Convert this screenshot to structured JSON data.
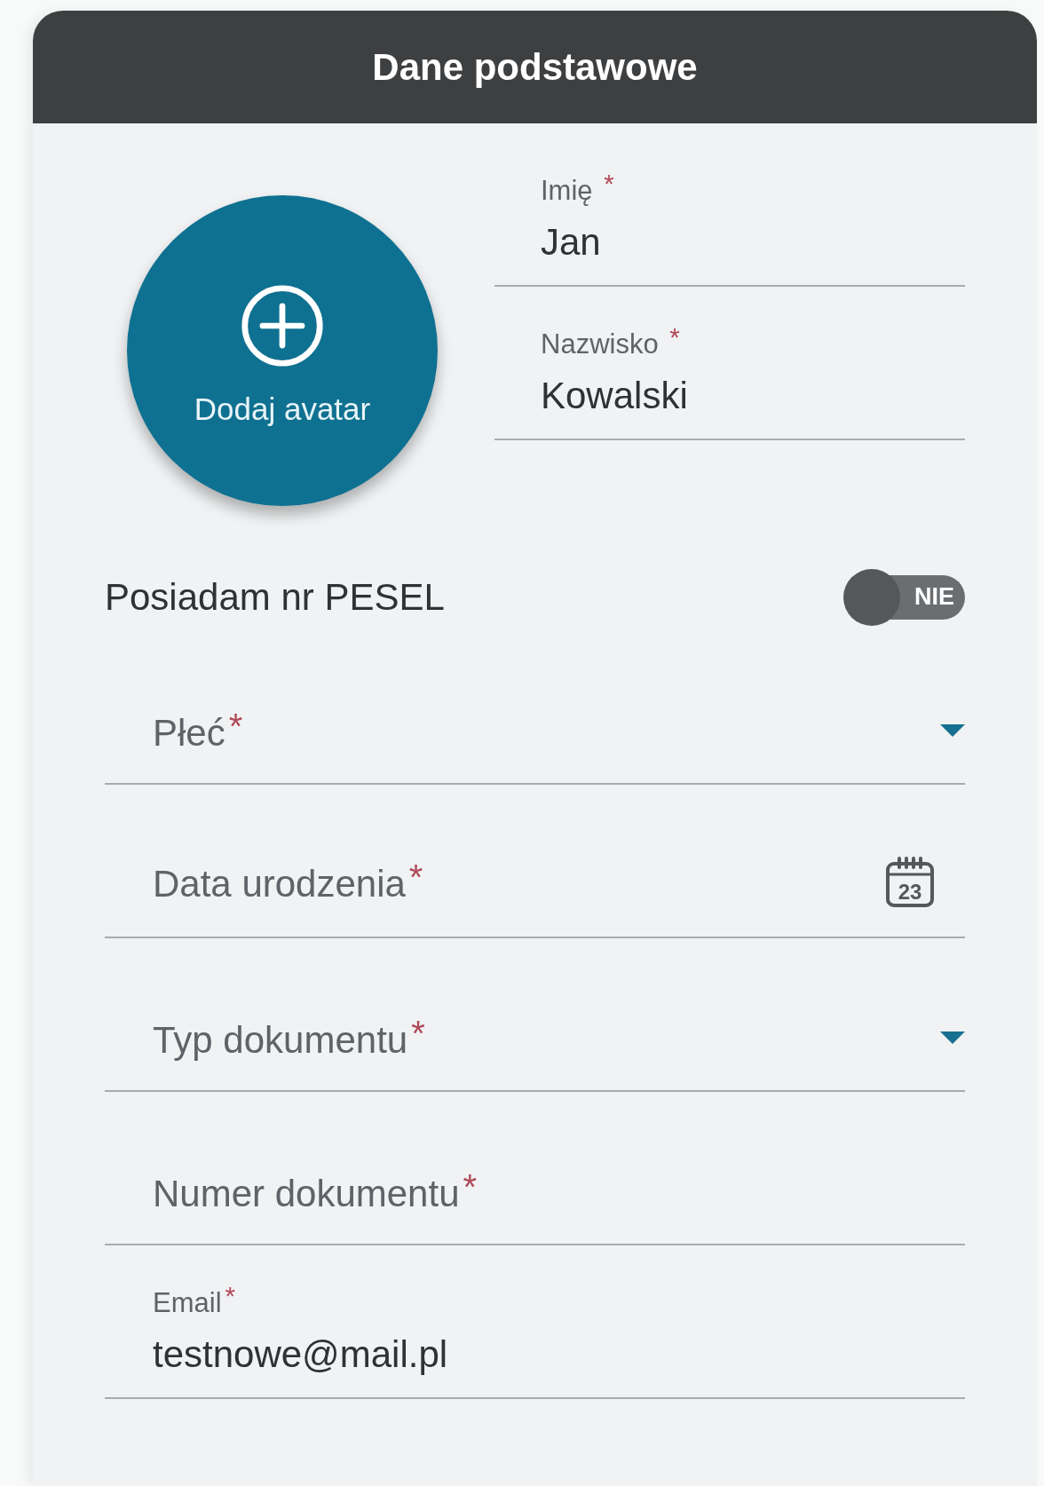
{
  "card": {
    "title": "Dane podstawowe"
  },
  "avatar": {
    "label": "Dodaj avatar"
  },
  "name_fields": [
    {
      "kind": "filled",
      "label": "Imię",
      "mark": "*",
      "value": "Jan"
    },
    {
      "kind": "filled",
      "label": "Nazwisko",
      "mark": "*",
      "value": "Kowalski"
    }
  ],
  "pesel": {
    "label": "Posiadam nr PESEL",
    "on": false,
    "toggle_text": "NIE"
  },
  "fields": [
    {
      "kind": "dropdown",
      "label": "Płeć",
      "mark": "*"
    },
    {
      "kind": "date",
      "label": "Data urodzenia",
      "mark": "*",
      "calendar_day": "23"
    },
    {
      "kind": "dropdown",
      "label": "Typ dokumentu",
      "mark": "*"
    },
    {
      "kind": "text",
      "label": "Numer dokumentu",
      "mark": "*"
    },
    {
      "kind": "filled",
      "label": "Email",
      "mark": "*",
      "value": "testnowe@mail.pl"
    }
  ]
}
